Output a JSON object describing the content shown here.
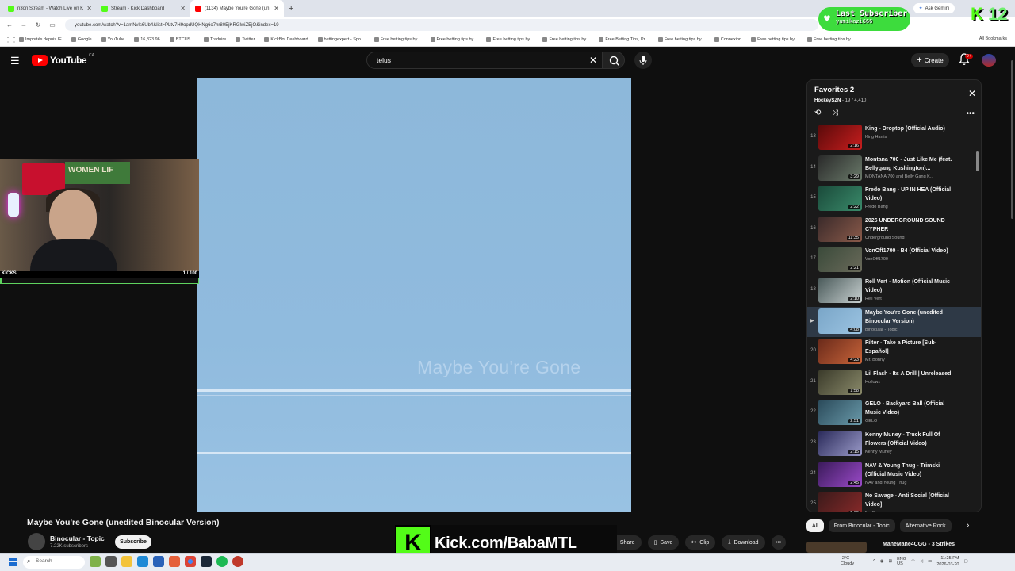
{
  "browser": {
    "tabs": [
      {
        "title": "n3on Stream - Watch Live on K",
        "color": "#53fc18",
        "active": false
      },
      {
        "title": "Stream - Kick Dashboard",
        "color": "#53fc18",
        "active": false
      },
      {
        "title": "(1134) Maybe You're Gone (un",
        "color": "#ff0000",
        "active": true
      }
    ],
    "new_tab": "+",
    "ask_gemini": "Ask Gemini",
    "url": "youtube.com/watch?v=1amNvls6Ub4&list=PLtv7H9opdUQHNg6o7hr80EjKRGlwiZEjO&index=19",
    "bookmarks": [
      "Importés depuis IE",
      "Google",
      "YouTube",
      "16,823.96",
      "BTCUS...",
      "Traduire",
      "Twitter",
      "KickBot Dashboard",
      "bettingexpert - Spo...",
      "Free betting tips by...",
      "Free betting tips by...",
      "Free betting tips by...",
      "Free betting tips by...",
      "Free Betting Tips, Pr...",
      "Free betting tips by...",
      "Connexion",
      "Free betting tips by...",
      "Free betting tips by..."
    ],
    "all_bookmarks": "All Bookmarks"
  },
  "overlay": {
    "last_subscriber_label": "Last Subscriber",
    "last_subscriber_name": "yamikazi666",
    "kick_counter": "12",
    "kicks_label": "KICKS",
    "kicks_count": "1 / 100",
    "kicks_progress": 0.01,
    "kick_url": "Kick.com/BabaMTL",
    "kick_logo": "K"
  },
  "youtube": {
    "wordmark": "YouTube",
    "country": "CA",
    "search_value": "telus",
    "create_label": "Create",
    "notif_badge": "9+",
    "video_art_text": "Maybe You're Gone",
    "video_title": "Maybe You're Gone (unedited Binocular Version)",
    "channel_name": "Binocular - Topic",
    "subscribers": "7.22K subscribers",
    "subscribe_label": "Subscribe",
    "actions": [
      "Share",
      "Save",
      "Clip",
      "Download"
    ],
    "chips": [
      "All",
      "From Binocular - Topic",
      "Alternative Rock"
    ],
    "next_up_title": "ManeMane4CGG - 3 Strikes"
  },
  "playlist": {
    "title": "Favorites 2",
    "owner": "HockeySZN",
    "position": "19 / 4,410",
    "items": [
      {
        "idx": "13",
        "title": "King - Droptop (Official Audio)",
        "artist": "King Harris",
        "dur": "2:16",
        "c1": "#5a0a0a",
        "c2": "#c81e1e",
        "current": false
      },
      {
        "idx": "14",
        "title": "Montana 700 - Just Like Me (feat. Bellygang Kushington)...",
        "artist": "MONTANA 700 and Belly Gang K...",
        "dur": "3:29",
        "c1": "#2a2a2a",
        "c2": "#6a7a6a",
        "current": false
      },
      {
        "idx": "15",
        "title": "Fredo Bang - UP IN HEA (Official Video)",
        "artist": "Fredo Bang",
        "dur": "2:22",
        "c1": "#1a4a3a",
        "c2": "#3a8a6a",
        "current": false
      },
      {
        "idx": "16",
        "title": "2026 UNDERGROUND SOUND CYPHER",
        "artist": "Underground Sound",
        "dur": "11:35",
        "c1": "#3a2a2a",
        "c2": "#8a5a4a",
        "current": false
      },
      {
        "idx": "17",
        "title": "VonOff1700 - B4 (Official Video)",
        "artist": "VonOff1700",
        "dur": "2:21",
        "c1": "#3a4a3a",
        "c2": "#6a6a5a",
        "current": false
      },
      {
        "idx": "18",
        "title": "Rell Vert - Motion (Official Music Video)",
        "artist": "Rell Vert",
        "dur": "2:10",
        "c1": "#4a5a5a",
        "c2": "#c8d0d0",
        "current": false
      },
      {
        "idx": "",
        "title": "Maybe You're Gone (unedited Binocular Version)",
        "artist": "Binocular - Topic",
        "dur": "4:08",
        "c1": "#7aa6c8",
        "c2": "#9cc4e2",
        "current": true
      },
      {
        "idx": "20",
        "title": "Filter - Take a Picture [Sub-Español]",
        "artist": "Mr. Bonny",
        "dur": "4:23",
        "c1": "#6a2a1a",
        "c2": "#c8643a",
        "current": false
      },
      {
        "idx": "21",
        "title": "Lil Flash - Its A Drill | Unreleased",
        "artist": "Hollowz",
        "dur": "1:58",
        "c1": "#3a3a2a",
        "c2": "#8a8a6a",
        "current": false
      },
      {
        "idx": "22",
        "title": "GELO - Backyard Ball (Official Music Video)",
        "artist": "GELO",
        "dur": "2:51",
        "c1": "#2a4a5a",
        "c2": "#6a9aaa",
        "current": false
      },
      {
        "idx": "23",
        "title": "Kenny Muney - Truck Full Of Flowers (Official Video)",
        "artist": "Kenny Muney",
        "dur": "2:15",
        "c1": "#2a2a5a",
        "c2": "#9a9ac8",
        "current": false
      },
      {
        "idx": "24",
        "title": "NAV & Young Thug - Trimski (Official Music Video)",
        "artist": "NAV and Young Thug",
        "dur": "2:45",
        "c1": "#3a1a5a",
        "c2": "#9a4ac8",
        "current": false
      },
      {
        "idx": "25",
        "title": "No Savage - Anti Social [Official Video]",
        "artist": "No Savage",
        "dur": "2:39",
        "c1": "#3a1a1a",
        "c2": "#8a2a2a",
        "current": false
      }
    ]
  },
  "taskbar": {
    "search": "Search",
    "weather_temp": "-2°C",
    "weather_desc": "Cloudy",
    "lang1": "ENG",
    "lang2": "US",
    "time": "11:25 PM",
    "date": "2026-03-20"
  }
}
